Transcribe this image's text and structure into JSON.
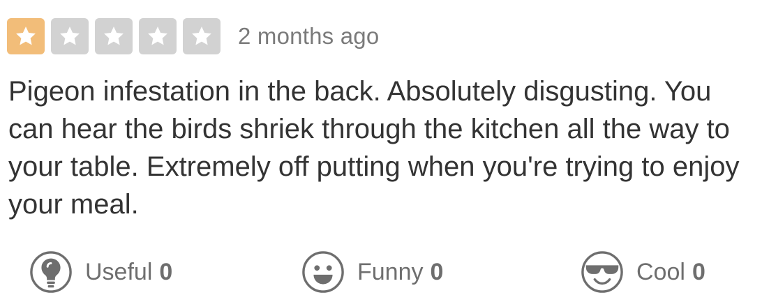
{
  "review": {
    "rating": 1,
    "max_rating": 5,
    "date": "2 months ago",
    "text": "Pigeon infestation in the back. Absolutely disgusting. You can hear the birds shriek through the kitchen all the way to your table. Extremely off putting when you're trying to enjoy your meal."
  },
  "actions": {
    "useful": {
      "label": "Useful",
      "count": "0",
      "icon": "lightbulb-icon"
    },
    "funny": {
      "label": "Funny",
      "count": "0",
      "icon": "smiley-icon"
    },
    "cool": {
      "label": "Cool",
      "count": "0",
      "icon": "sunglasses-icon"
    }
  },
  "colors": {
    "star_filled": "#f2bd79",
    "star_empty": "#d2d2d2",
    "text": "#333333",
    "muted": "#7a7a7a",
    "action": "#6e6e6e"
  }
}
